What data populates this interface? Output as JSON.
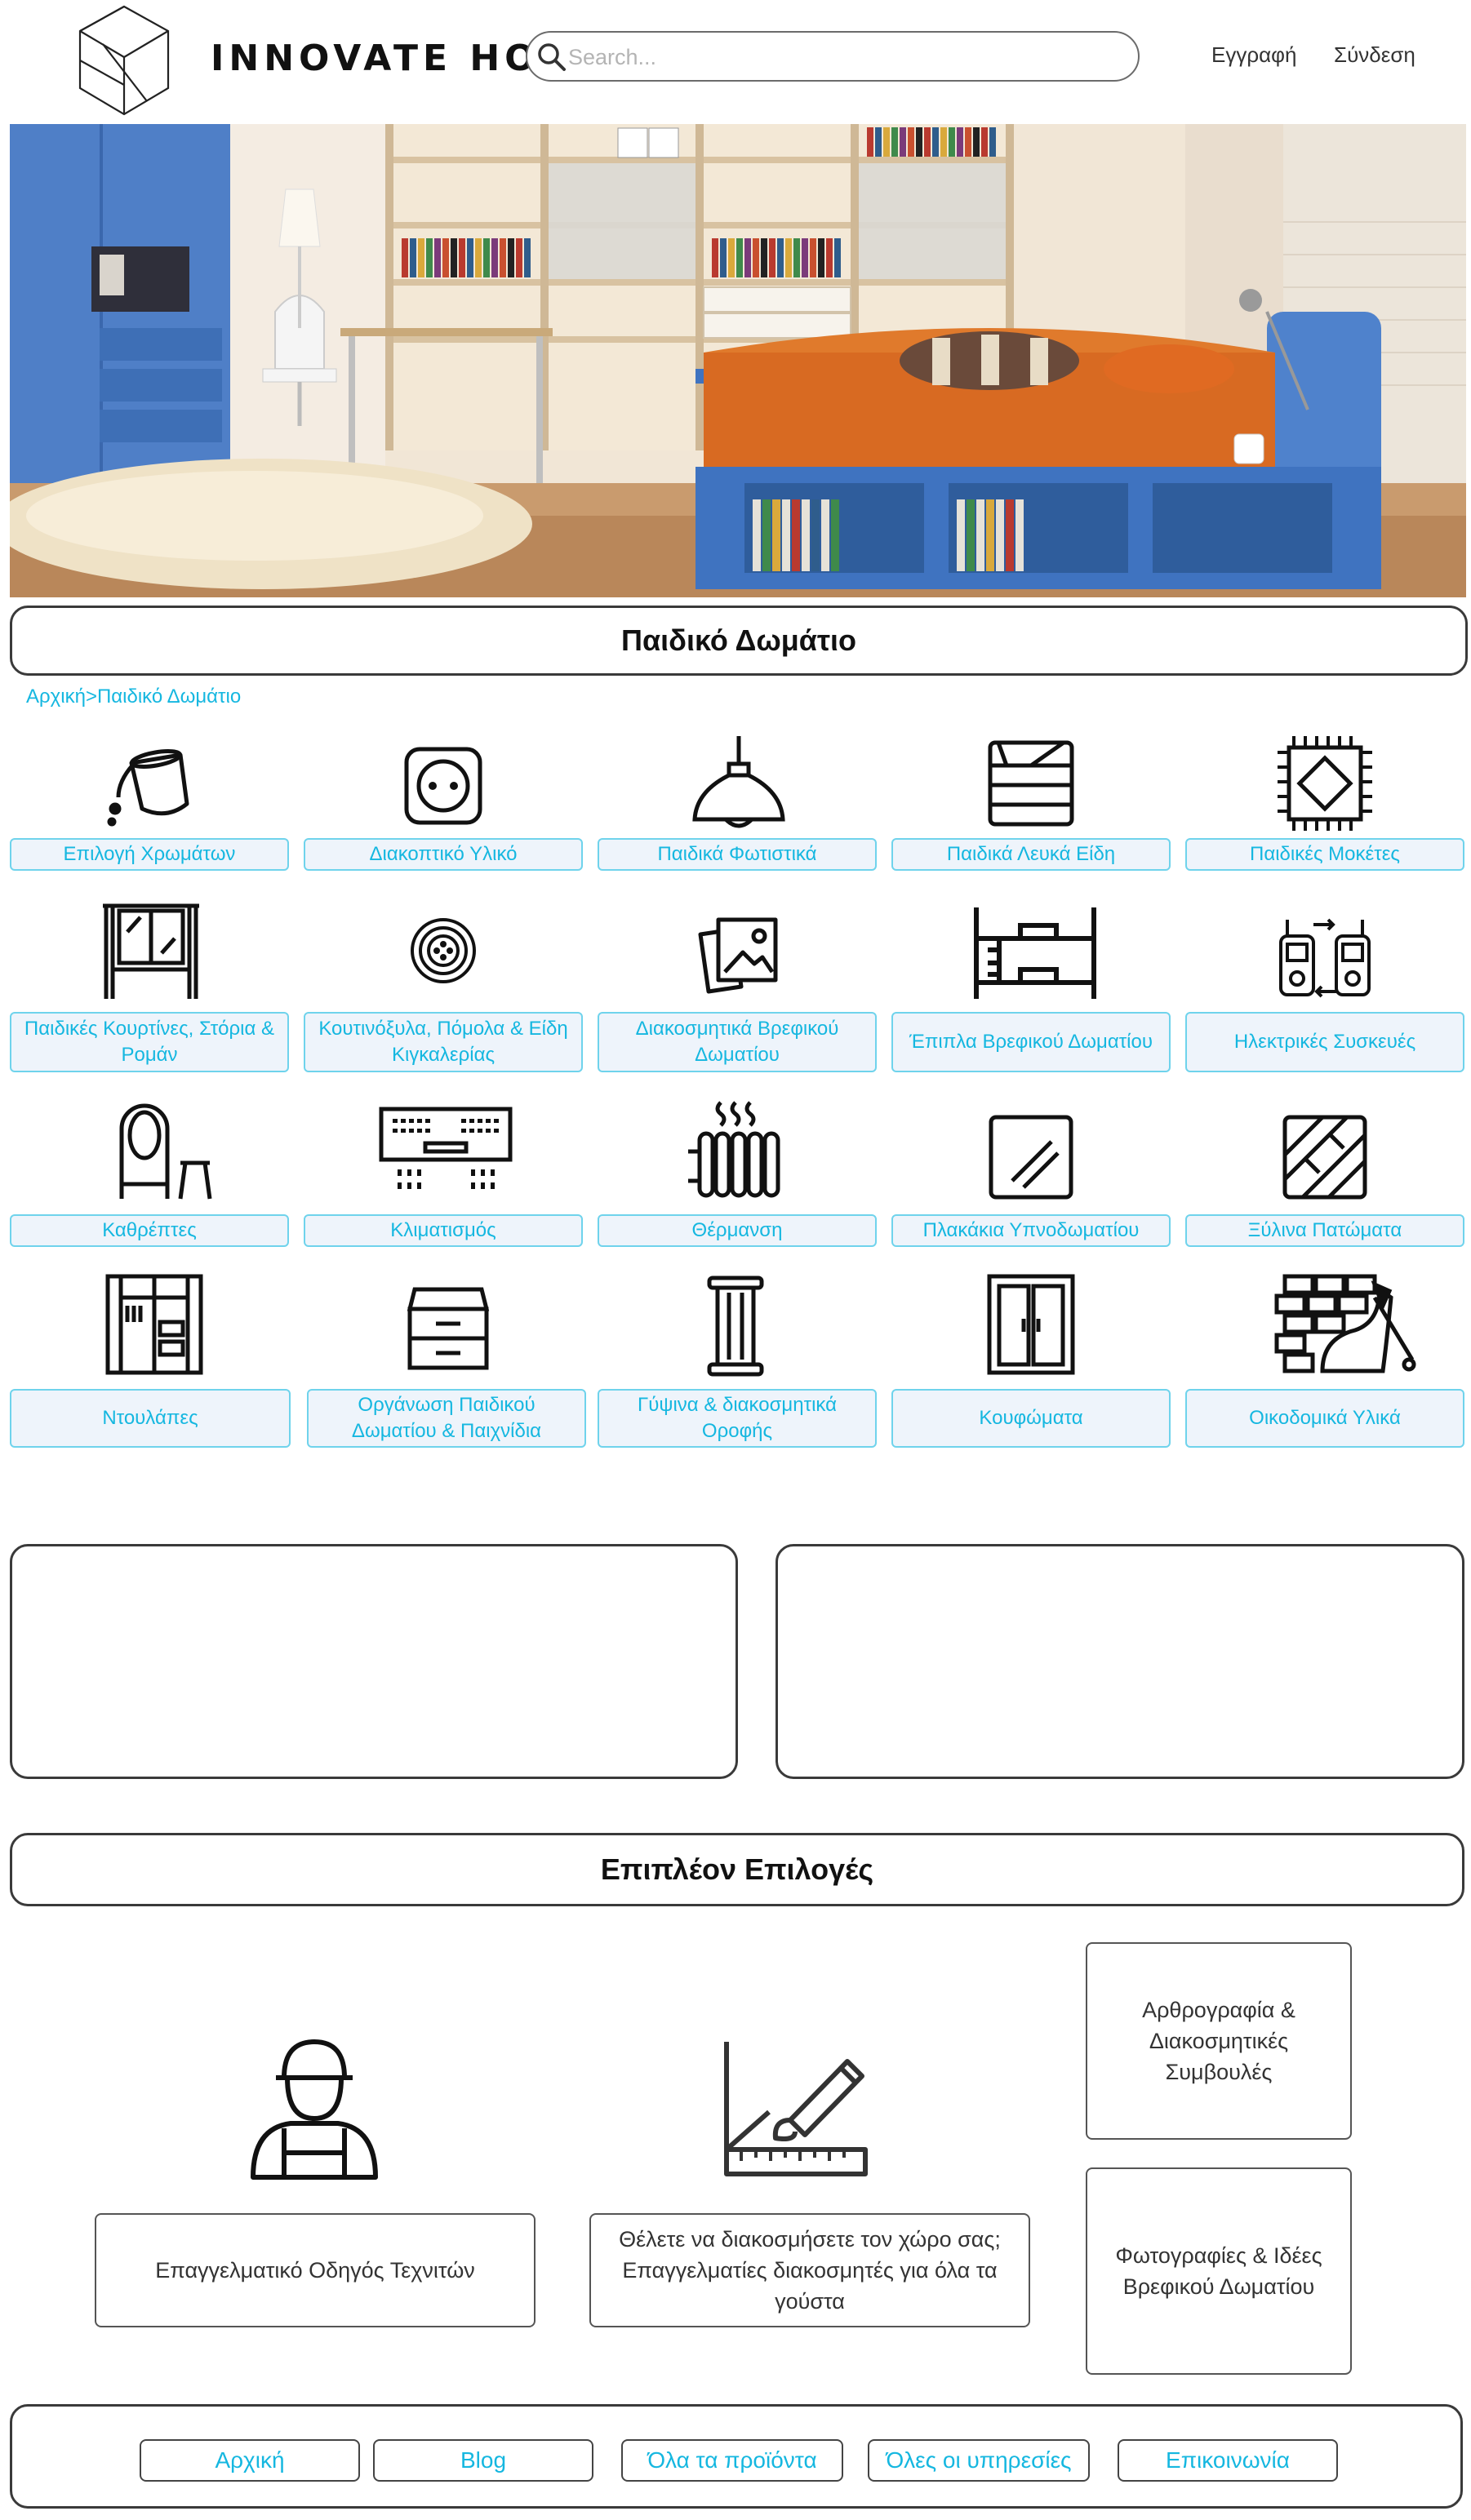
{
  "header": {
    "brand": "INNOVATE HOME",
    "search_placeholder": "Search...",
    "register": "Εγγραφή",
    "login": "Σύνδεση"
  },
  "page_title": "Παιδικό Δωμάτιο",
  "breadcrumb": {
    "home": "Αρχική",
    "separator": ">",
    "current": "Παιδικό Δωμάτιο"
  },
  "categories": [
    {
      "label": "Επιλογή Χρωμάτων",
      "icon": "paint-bucket-icon"
    },
    {
      "label": "Διακοπτικό Υλικό",
      "icon": "power-socket-icon"
    },
    {
      "label": "Παιδικά Φωτιστικά",
      "icon": "pendant-lamp-icon"
    },
    {
      "label": "Παιδικά Λευκά Είδη",
      "icon": "folded-linens-icon"
    },
    {
      "label": "Παιδικές Μοκέτες",
      "icon": "rug-icon"
    },
    {
      "label": "Παιδικές Κουρτίνες, Στόρια & Ρομάν",
      "icon": "curtains-icon"
    },
    {
      "label": "Κουτινόξυλα, Πόμολα & Είδη Κιγκαλερίας",
      "icon": "knob-icon"
    },
    {
      "label": "Διακοσμητικά Βρεφικού Δωματίου",
      "icon": "picture-frames-icon"
    },
    {
      "label": "Έπιπλα Βρεφικού Δωματίου",
      "icon": "bunk-bed-icon"
    },
    {
      "label": "Ηλεκτρικές Συσκευές",
      "icon": "walkie-talkie-icon"
    },
    {
      "label": "Καθρέπτες",
      "icon": "mirror-stool-icon"
    },
    {
      "label": "Κλιματισμός",
      "icon": "air-conditioner-icon"
    },
    {
      "label": "Θέρμανση",
      "icon": "radiator-icon"
    },
    {
      "label": "Πλακάκια Υπνοδωματίου",
      "icon": "tile-icon"
    },
    {
      "label": "Ξύλινα Πατώματα",
      "icon": "wood-floor-icon"
    },
    {
      "label": "Ντουλάπες",
      "icon": "wardrobe-icon"
    },
    {
      "label": "Οργάνωση Παιδικού Δωματίου & Παιχνίδια",
      "icon": "drawers-icon"
    },
    {
      "label": "Γύψινα & διακοσμητικά Οροφής",
      "icon": "column-icon"
    },
    {
      "label": "Κουφώματα",
      "icon": "window-frame-icon"
    },
    {
      "label": "Οικοδομικά Υλικά",
      "icon": "bricks-trowel-icon"
    }
  ],
  "extra_title": "Επιπλέον Επιλογές",
  "extra": {
    "craftsmen": "Επαγγελματικό Οδηγός Τεχνιτών",
    "decorators": "Θέλετε να διακοσμήσετε τον χώρο σας; Επαγγελματίες διακοσμητές για όλα τα γούστα",
    "articles": "Αρθρογραφία & Διακοσμητικές Συμβουλές",
    "photos": "Φωτογραφίες & Ιδέες Βρεφικού Δωματίου"
  },
  "footer": {
    "home": "Αρχική",
    "blog": "Blog",
    "products": "Όλα τα προϊόντα",
    "services": "Όλες οι υπηρεσίες",
    "contact": "Επικοινωνία"
  }
}
